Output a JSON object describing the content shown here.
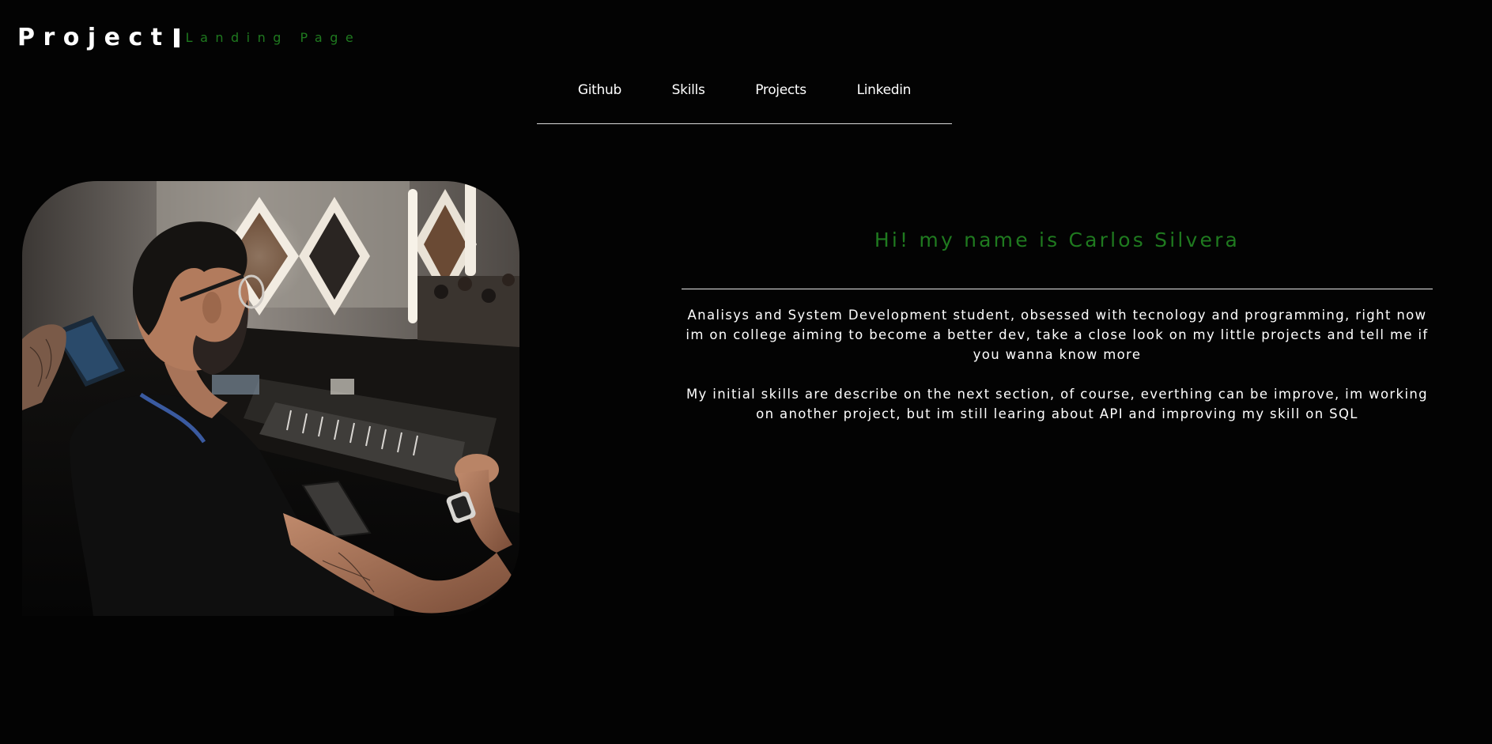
{
  "header": {
    "brand_title": "Project",
    "brand_subtitle": "Landing Page",
    "accent_color": "#1f7a1f"
  },
  "nav": {
    "items": [
      {
        "label": "Github"
      },
      {
        "label": "Skills"
      },
      {
        "label": "Projects"
      },
      {
        "label": "Linkedin"
      }
    ]
  },
  "main": {
    "photo_icon": "profile-photo",
    "greeting": "Hi! my name is Carlos Silvera",
    "paragraphs": [
      "Analisys and System Development student, obsessed with tecnology and programming, right now im on college aiming to become a better dev, take a close look on my little projects and tell me if you wanna know more",
      "My initial skills are describe on the next section, of course, everthing can be improve, im working on another project, but im still learing about API and improving my skill on SQL"
    ]
  }
}
